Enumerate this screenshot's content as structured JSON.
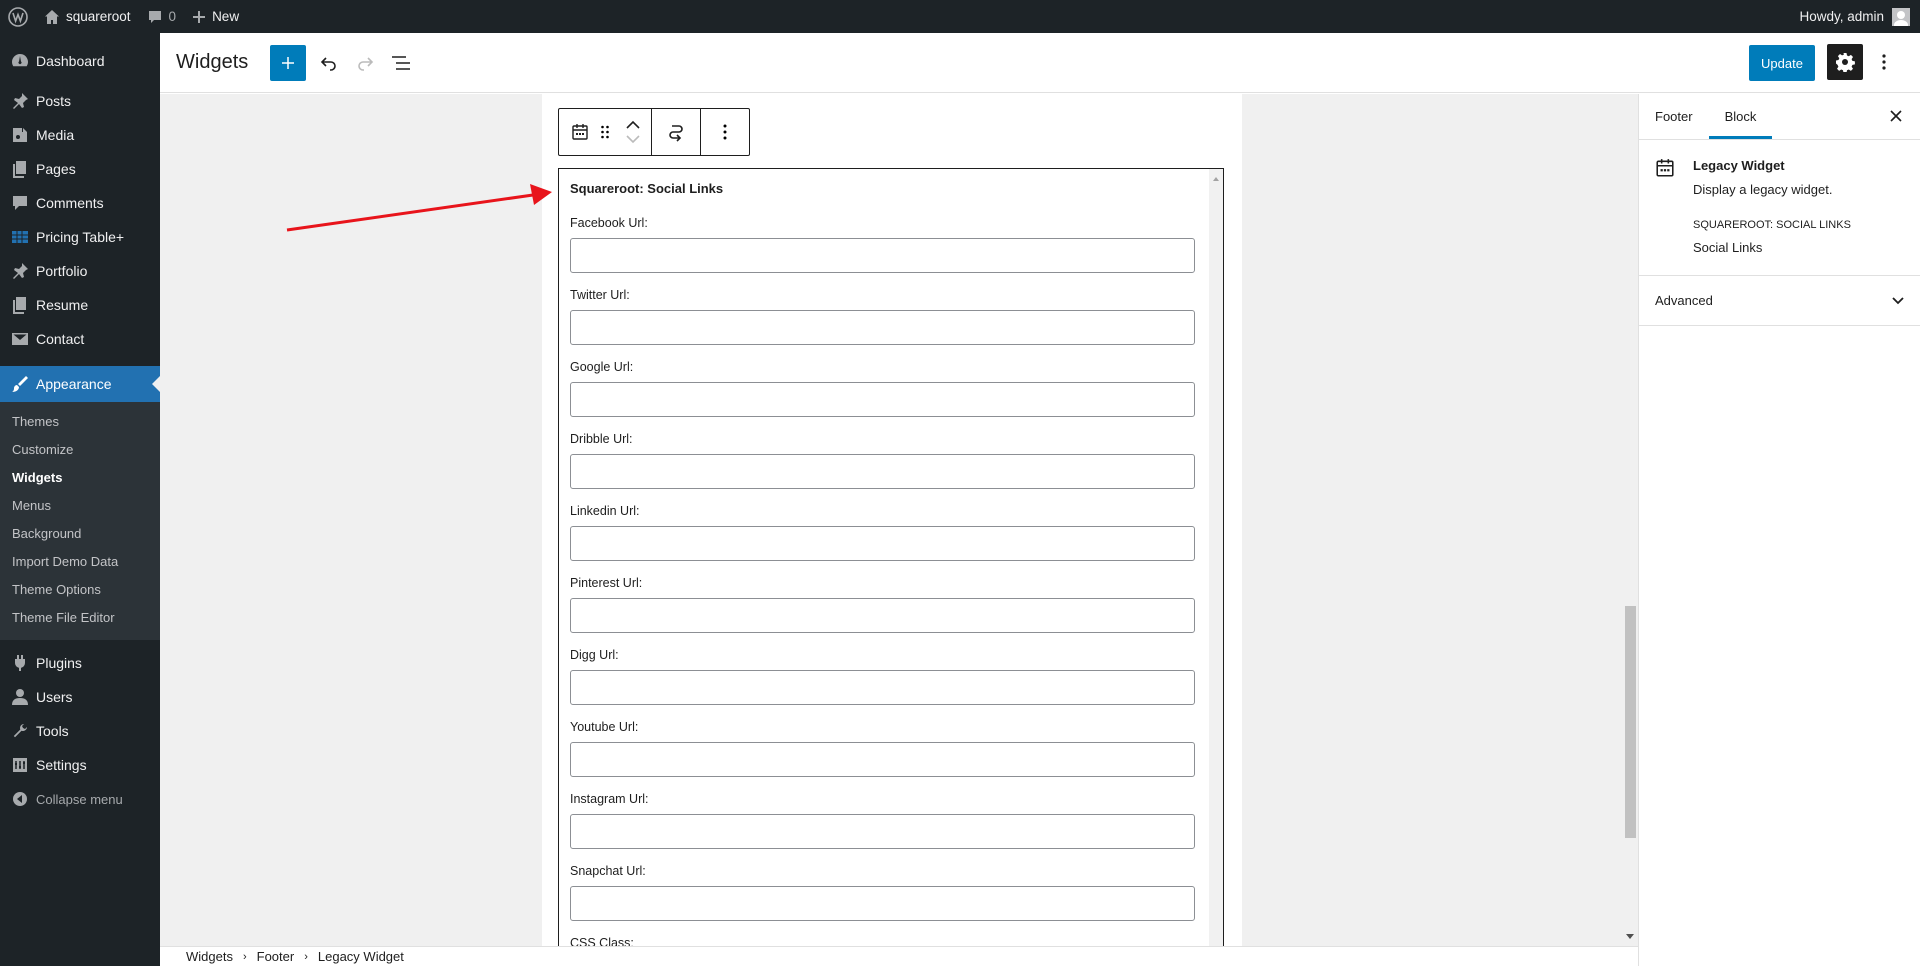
{
  "admin_bar": {
    "site_name": "squareroot",
    "comments_count": "0",
    "new_label": "New",
    "greeting": "Howdy, admin"
  },
  "sidebar": {
    "top_items": [
      {
        "label": "Dashboard",
        "icon": "dashboard-icon"
      }
    ],
    "items": [
      {
        "label": "Posts",
        "icon": "pin-icon"
      },
      {
        "label": "Media",
        "icon": "media-icon"
      },
      {
        "label": "Pages",
        "icon": "pages-icon"
      },
      {
        "label": "Comments",
        "icon": "comment-icon"
      },
      {
        "label": "Pricing Table+",
        "icon": "table-icon"
      },
      {
        "label": "Portfolio",
        "icon": "pin-icon"
      },
      {
        "label": "Resume",
        "icon": "pages-icon"
      },
      {
        "label": "Contact",
        "icon": "mail-icon"
      }
    ],
    "current": {
      "label": "Appearance",
      "icon": "brush-icon"
    },
    "submenu": [
      "Themes",
      "Customize",
      "Widgets",
      "Menus",
      "Background",
      "Import Demo Data",
      "Theme Options",
      "Theme File Editor"
    ],
    "submenu_active": "Widgets",
    "bottom_items": [
      {
        "label": "Plugins",
        "icon": "plug-icon"
      },
      {
        "label": "Users",
        "icon": "user-icon"
      },
      {
        "label": "Tools",
        "icon": "wrench-icon"
      },
      {
        "label": "Settings",
        "icon": "settings-icon"
      }
    ],
    "collapse_label": "Collapse menu"
  },
  "header": {
    "title": "Widgets",
    "update_label": "Update"
  },
  "widget": {
    "title": "Squareroot: Social Links",
    "fields": [
      {
        "label": "Facebook Url:",
        "value": ""
      },
      {
        "label": "Twitter Url:",
        "value": ""
      },
      {
        "label": "Google Url:",
        "value": ""
      },
      {
        "label": "Dribble Url:",
        "value": ""
      },
      {
        "label": "Linkedin Url:",
        "value": ""
      },
      {
        "label": "Pinterest Url:",
        "value": ""
      },
      {
        "label": "Digg Url:",
        "value": ""
      },
      {
        "label": "Youtube Url:",
        "value": ""
      },
      {
        "label": "Instagram Url:",
        "value": ""
      },
      {
        "label": "Snapchat Url:",
        "value": ""
      },
      {
        "label": "CSS Class:",
        "value": ""
      }
    ]
  },
  "breadcrumbs": [
    "Widgets",
    "Footer",
    "Legacy Widget"
  ],
  "panel": {
    "tabs": [
      "Footer",
      "Block"
    ],
    "active_tab": "Block",
    "block_name": "Legacy Widget",
    "block_description": "Display a legacy widget.",
    "widget_type": "Squareroot: Social Links",
    "widget_name": "Social Links",
    "advanced_label": "Advanced"
  },
  "colors": {
    "accent": "#007cba",
    "admin_current": "#2271b1",
    "sidebar_bg": "#1d2327",
    "annotation_arrow": "#e8141b"
  }
}
